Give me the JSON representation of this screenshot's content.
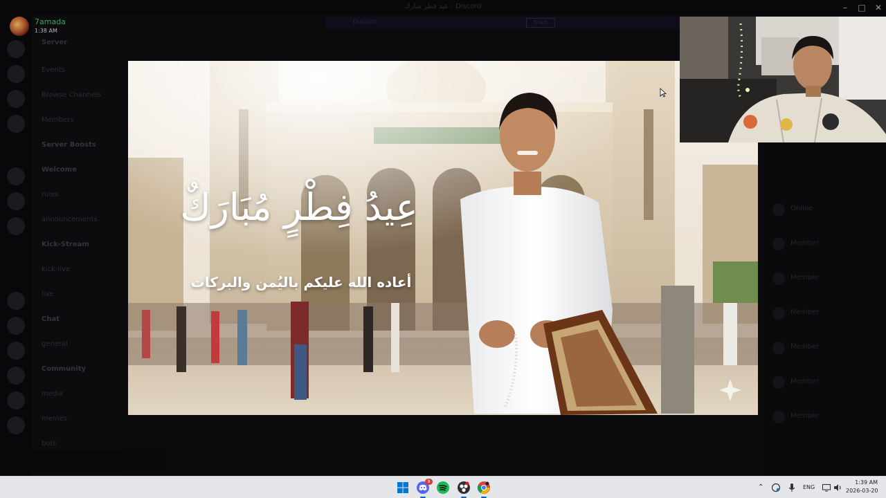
{
  "window": {
    "title": "عيد فطر مبارك - Discord"
  },
  "stream_header": {
    "username": "7amada",
    "timestamp": "1:38 AM"
  },
  "background_ui": {
    "server_name": "Server",
    "banner_text": "Discord",
    "banner_button": "Start",
    "channel_rows": [
      {
        "label": "Events",
        "cat": false
      },
      {
        "label": "Browse Channels",
        "cat": false
      },
      {
        "label": "Members",
        "cat": false
      },
      {
        "label": "Server Boosts",
        "cat": true
      },
      {
        "label": "Welcome",
        "cat": true
      },
      {
        "label": "rules",
        "cat": false
      },
      {
        "label": "announcements",
        "cat": false
      },
      {
        "label": "Kick-Stream",
        "cat": true
      },
      {
        "label": "kick-live",
        "cat": false
      },
      {
        "label": "live",
        "cat": false
      },
      {
        "label": "Chat",
        "cat": true
      },
      {
        "label": "general",
        "cat": false
      },
      {
        "label": "Community",
        "cat": true
      },
      {
        "label": "media",
        "cat": false
      },
      {
        "label": "memes",
        "cat": false
      },
      {
        "label": "bots",
        "cat": false
      }
    ],
    "member_rows": [
      "Online",
      "Member",
      "Member",
      "Member",
      "Member",
      "Member",
      "Member"
    ]
  },
  "greeting": {
    "title": "عِيدُ فِطْرٍ مُبَارَكٌ",
    "subtitle": "أعاده الله عليكم باليُمن والبركات"
  },
  "taskbar": {
    "apps": [
      {
        "name": "windows-start-icon",
        "color": "#0078d4"
      },
      {
        "name": "discord-icon",
        "color": "#5865f2",
        "badge": "9"
      },
      {
        "name": "spotify-icon",
        "color": "#1db954"
      },
      {
        "name": "obs-icon",
        "color": "#302e31"
      },
      {
        "name": "chrome-icon",
        "color": "#db4437"
      }
    ],
    "language": "ENG",
    "clock_time": "1:39 AM",
    "clock_date": "2026-03-20"
  }
}
